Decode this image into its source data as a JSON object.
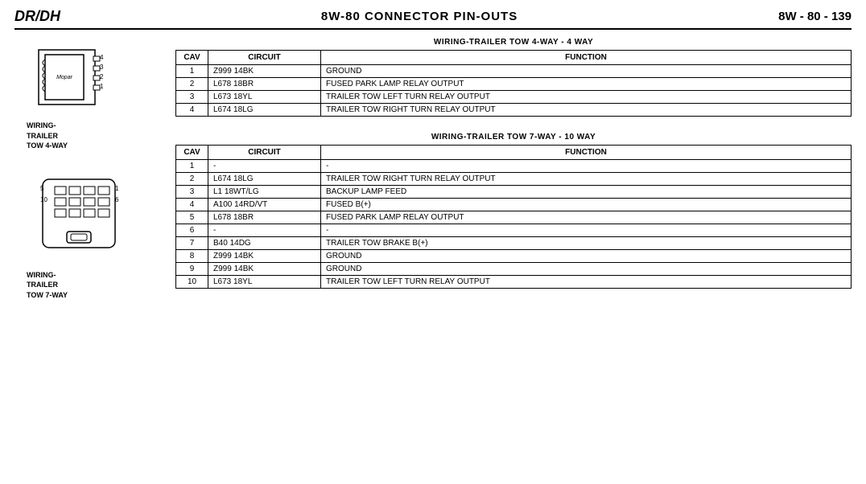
{
  "header": {
    "left": "DR/DH",
    "center": "8W-80  CONNECTOR PIN-OUTS",
    "right": "8W - 80 - 139"
  },
  "diagram1": {
    "label_line1": "WIRING-",
    "label_line2": "TRAILER",
    "label_line3": "TOW 4-WAY"
  },
  "diagram2": {
    "label_line1": "WIRING-",
    "label_line2": "TRAILER",
    "label_line3": "TOW 7-WAY"
  },
  "table1": {
    "title": "WIRING-TRAILER TOW 4-WAY - 4 WAY",
    "col_cav": "CAV",
    "col_circuit": "CIRCUIT",
    "col_function": "FUNCTION",
    "rows": [
      {
        "cav": "1",
        "circuit": "Z999 14BK",
        "function": "GROUND"
      },
      {
        "cav": "2",
        "circuit": "L678 18BR",
        "function": "FUSED PARK LAMP RELAY OUTPUT"
      },
      {
        "cav": "3",
        "circuit": "L673 18YL",
        "function": "TRAILER TOW LEFT TURN RELAY OUTPUT"
      },
      {
        "cav": "4",
        "circuit": "L674 18LG",
        "function": "TRAILER TOW RIGHT TURN RELAY OUTPUT"
      }
    ]
  },
  "table2": {
    "title": "WIRING-TRAILER TOW 7-WAY - 10 WAY",
    "col_cav": "CAV",
    "col_circuit": "CIRCUIT",
    "col_function": "FUNCTION",
    "rows": [
      {
        "cav": "1",
        "circuit": "-",
        "function": "-"
      },
      {
        "cav": "2",
        "circuit": "L674 18LG",
        "function": "TRAILER TOW RIGHT TURN RELAY OUTPUT"
      },
      {
        "cav": "3",
        "circuit": "L1 18WT/LG",
        "function": "BACKUP LAMP FEED"
      },
      {
        "cav": "4",
        "circuit": "A100 14RD/VT",
        "function": "FUSED B(+)"
      },
      {
        "cav": "5",
        "circuit": "L678 18BR",
        "function": "FUSED PARK LAMP RELAY OUTPUT"
      },
      {
        "cav": "6",
        "circuit": "-",
        "function": "-"
      },
      {
        "cav": "7",
        "circuit": "B40 14DG",
        "function": "TRAILER TOW BRAKE B(+)"
      },
      {
        "cav": "8",
        "circuit": "Z999 14BK",
        "function": "GROUND"
      },
      {
        "cav": "9",
        "circuit": "Z999 14BK",
        "function": "GROUND"
      },
      {
        "cav": "10",
        "circuit": "L673 18YL",
        "function": "TRAILER TOW LEFT TURN RELAY OUTPUT"
      }
    ]
  }
}
